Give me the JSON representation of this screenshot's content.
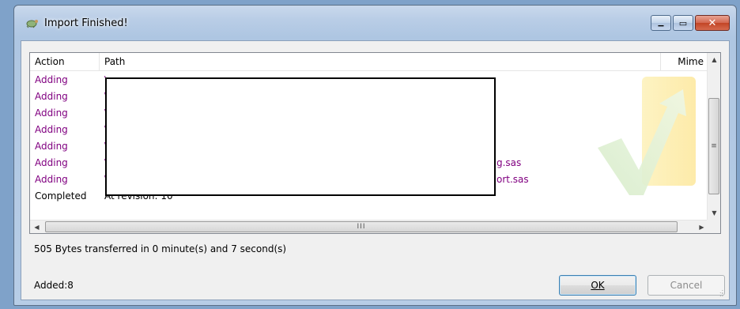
{
  "window": {
    "title": "Import Finished!",
    "minimize_glyph": "▁",
    "maximize_glyph": "▭",
    "close_glyph": "✕"
  },
  "list": {
    "columns": [
      "Action",
      "Path",
      "Mime"
    ],
    "rows": [
      {
        "action": "Adding",
        "path": "\\",
        "suffix": ""
      },
      {
        "action": "Adding",
        "path": "\\",
        "suffix": ""
      },
      {
        "action": "Adding",
        "path": "\\",
        "suffix": ""
      },
      {
        "action": "Adding",
        "path": "\\",
        "suffix": ""
      },
      {
        "action": "Adding",
        "path": "\\",
        "suffix": ""
      },
      {
        "action": "Adding",
        "path": "\\",
        "suffix": "g.sas"
      },
      {
        "action": "Adding",
        "path": "\\",
        "suffix": "ort.sas"
      },
      {
        "action": "Completed",
        "path": "At revision: 10",
        "suffix": ""
      }
    ]
  },
  "status": {
    "transfer": "505 Bytes transferred in 0 minute(s) and 7 second(s)",
    "added": "Added:8"
  },
  "buttons": {
    "ok": "OK",
    "cancel": "Cancel"
  },
  "scroll": {
    "up": "▲",
    "down": "▼",
    "left": "◀",
    "right": "▶",
    "v_grip": "≡",
    "h_grip": "III"
  },
  "icons": {
    "app": "tortoisesvn-icon",
    "watermark": "tortoise-watermark-icon"
  },
  "colors": {
    "adding": "#800080",
    "completed": "#000000"
  }
}
